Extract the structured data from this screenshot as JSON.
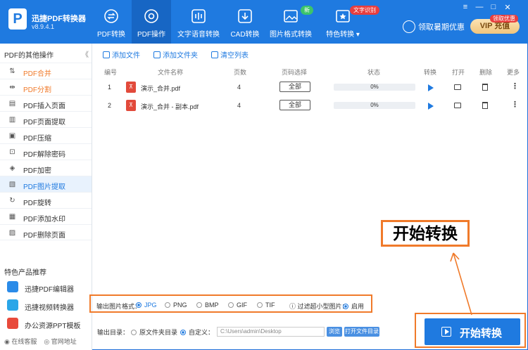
{
  "app": {
    "title": "迅捷PDF转换器",
    "version": "v8.9.4.1",
    "logo_letter": "P"
  },
  "nav": [
    {
      "label": "PDF转换",
      "icon": "convert-icon"
    },
    {
      "label": "PDF操作",
      "icon": "gear-icon"
    },
    {
      "label": "文字语音转换",
      "icon": "audio-wave-icon"
    },
    {
      "label": "CAD转换",
      "icon": "download-box-icon"
    },
    {
      "label": "图片格式转换",
      "icon": "image-icon",
      "badge": "新"
    },
    {
      "label": "特色转换",
      "icon": "star-box-icon",
      "badge": "文字识别"
    }
  ],
  "header_right": {
    "summer_label": "领取暑期优惠",
    "vip_label": "VIP 充值",
    "vip_tag": "领取优惠"
  },
  "window_controls": {
    "menu": "≡",
    "min": "—",
    "max": "□",
    "close": "✕"
  },
  "sidebar": {
    "title": "PDF的其他操作",
    "collapse": "《",
    "items": [
      {
        "label": "PDF合并",
        "icon": "merge-icon"
      },
      {
        "label": "PDF分割",
        "icon": "split-icon"
      },
      {
        "label": "PDF插入页面",
        "icon": "insert-page-icon"
      },
      {
        "label": "PDF页面提取",
        "icon": "extract-page-icon"
      },
      {
        "label": "PDF压缩",
        "icon": "compress-icon"
      },
      {
        "label": "PDF解除密码",
        "icon": "unlock-icon"
      },
      {
        "label": "PDF加密",
        "icon": "shield-icon"
      },
      {
        "label": "PDF图片提取",
        "icon": "image-extract-icon"
      },
      {
        "label": "PDF旋转",
        "icon": "rotate-icon"
      },
      {
        "label": "PDF添加水印",
        "icon": "watermark-icon"
      },
      {
        "label": "PDF删除页面",
        "icon": "delete-page-icon"
      }
    ],
    "featured_title": "特色产品推荐",
    "featured": [
      {
        "label": "迅捷PDF编辑器",
        "color": "#2a8be8"
      },
      {
        "label": "迅捷视频转换器",
        "color": "#2aa6e8"
      },
      {
        "label": "办公资源PPT模板",
        "color": "#e84a3b"
      }
    ],
    "footer": {
      "service": "在线客服",
      "website": "官网地址"
    }
  },
  "toolbar": {
    "add_file": "添加文件",
    "add_folder": "添加文件夹",
    "clear_list": "清空列表"
  },
  "table": {
    "headers": {
      "num": "编号",
      "name": "文件名称",
      "pages": "页数",
      "page_select": "页码选择",
      "status": "状态",
      "convert": "转换",
      "open": "打开",
      "delete": "删除",
      "more": "更多"
    },
    "rows": [
      {
        "num": "1",
        "name": "演示_合并.pdf",
        "pages": "4",
        "page_select": "全部",
        "progress": "0%"
      },
      {
        "num": "2",
        "name": "演示_合并 - 副本.pdf",
        "pages": "4",
        "page_select": "全部",
        "progress": "0%"
      }
    ]
  },
  "options": {
    "format_label": "输出图片格式：",
    "formats": [
      "JPG",
      "PNG",
      "BMP",
      "GIF",
      "TIF"
    ],
    "selected_format": "JPG",
    "filter_label": "过滤超小型图片：",
    "filter_value": "启用"
  },
  "output": {
    "label": "输出目录：",
    "option_original": "原文件夹目录",
    "option_custom": "自定义：",
    "path": "C:\\Users\\admin\\Desktop",
    "browse": "浏览",
    "open_folder": "打开文件目录"
  },
  "start_button": "开始转换",
  "callout": "开始转换",
  "colors": {
    "primary": "#1f7ae0",
    "highlight": "#f07a2a"
  }
}
